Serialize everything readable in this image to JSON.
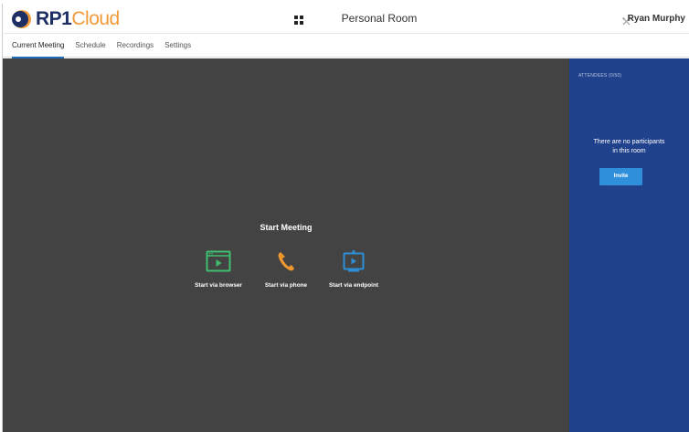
{
  "header": {
    "logo_main": "RP1",
    "logo_suffix": "Cloud",
    "title": "Personal Room",
    "user_name": "Ryan Murphy"
  },
  "tabs": [
    {
      "label": "Current Meeting",
      "active": true
    },
    {
      "label": "Schedule",
      "active": false
    },
    {
      "label": "Recordings",
      "active": false
    },
    {
      "label": "Settings",
      "active": false
    }
  ],
  "main": {
    "title": "Start Meeting",
    "options": [
      {
        "label": "Start via browser",
        "icon": "browser-icon",
        "color": "#3fbf6f"
      },
      {
        "label": "Start via phone",
        "icon": "phone-icon",
        "color": "#f0962e"
      },
      {
        "label": "Start via endpoint",
        "icon": "endpoint-icon",
        "color": "#2e8fd6"
      }
    ]
  },
  "attendees": {
    "header": "ATTENDEES (0/50)",
    "empty_line1": "There are no participants",
    "empty_line2": "in this room",
    "invite_label": "Invite"
  },
  "colors": {
    "stage_bg": "#434343",
    "panel_bg": "#20418b",
    "accent": "#2f8fdb",
    "brand_navy": "#1d2f64",
    "brand_orange": "#f29a38"
  }
}
